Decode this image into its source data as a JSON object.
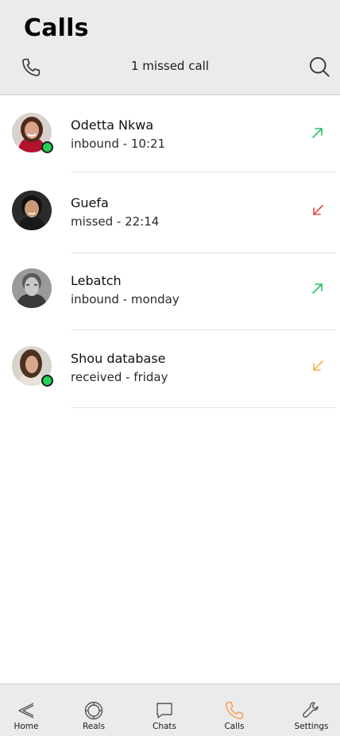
{
  "header": {
    "title": "Calls",
    "missed_text": "1 missed call"
  },
  "calls": [
    {
      "name": "Odetta Nkwa",
      "detail": "inbound - 10:21",
      "direction": "outgoing-arrow-icon",
      "arrow_color": "#22c55e",
      "online": true
    },
    {
      "name": "Guefa",
      "detail": "missed - 22:14",
      "direction": "missed-arrow-icon",
      "arrow_color": "#ef4444",
      "online": false
    },
    {
      "name": "Lebatch",
      "detail": "inbound - monday",
      "direction": "outgoing-arrow-icon",
      "arrow_color": "#22c55e",
      "online": false
    },
    {
      "name": "Shou database",
      "detail": "received - friday",
      "direction": "received-arrow-icon",
      "arrow_color": "#f5b342",
      "online": true
    }
  ],
  "nav": {
    "items": [
      {
        "label": "Home",
        "icon": "back-arrow-icon"
      },
      {
        "label": "Reals",
        "icon": "reels-icon"
      },
      {
        "label": "Chats",
        "icon": "chat-bubble-icon"
      },
      {
        "label": "Calls",
        "icon": "phone-icon",
        "active": true
      },
      {
        "label": "Settings",
        "icon": "wrench-icon"
      }
    ],
    "active_color": "#f5a25d"
  },
  "colors": {
    "header_bg": "#ebebeb",
    "online": "#22d456"
  }
}
